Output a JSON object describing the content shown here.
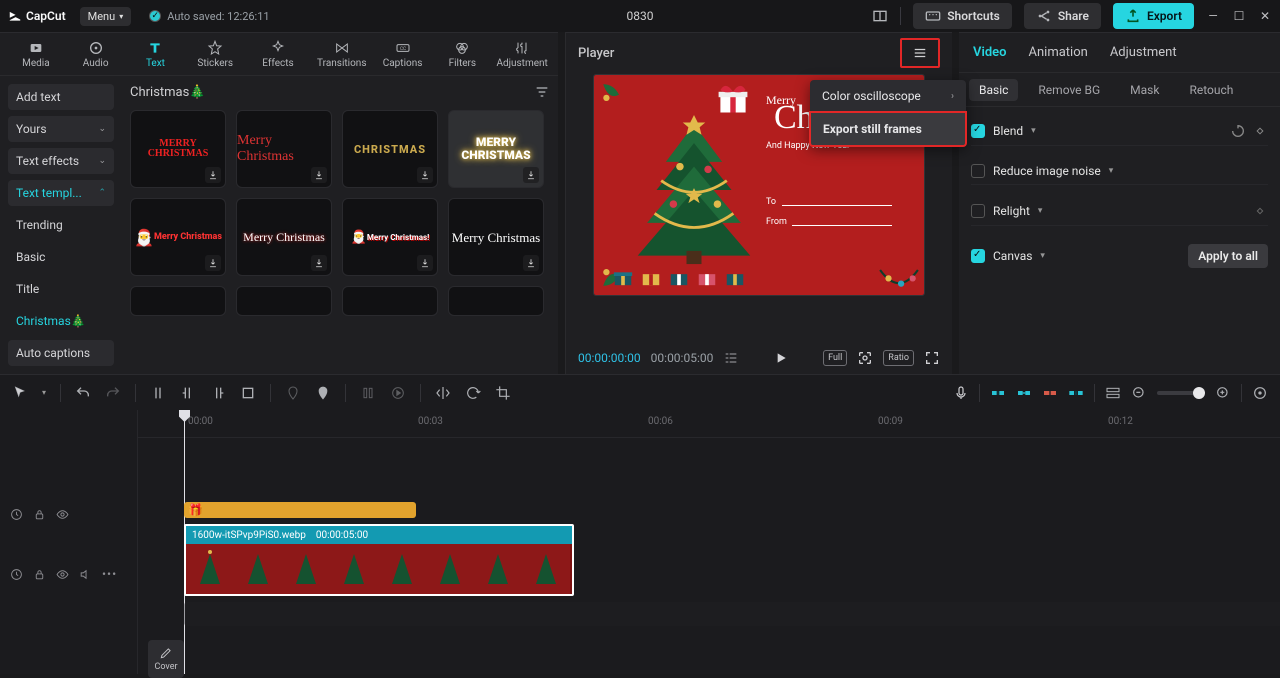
{
  "app": {
    "name": "CapCut",
    "menu": "Menu",
    "autosave": "Auto saved: 12:26:11",
    "project": "0830"
  },
  "titlebar": {
    "shortcuts": "Shortcuts",
    "share": "Share",
    "export": "Export"
  },
  "modules": [
    "Media",
    "Audio",
    "Text",
    "Stickers",
    "Effects",
    "Transitions",
    "Captions",
    "Filters",
    "Adjustment"
  ],
  "modules_active_index": 2,
  "sidebar": {
    "addtext": "Add text",
    "yours": "Yours",
    "texteffects": "Text effects",
    "texttemplates": "Text templ...",
    "trending": "Trending",
    "basic": "Basic",
    "title": "Title",
    "christmas": "Christmas🎄",
    "autocaptions": "Auto captions"
  },
  "gallery": {
    "heading": "Christmas🎄",
    "thumbs": [
      "MERRY CHRISTMAS",
      "Merry Christmas",
      "CHRISTMAS",
      "MERRY CHRISTMAS",
      "Merry Christmas",
      "Merry Christmas",
      "Merry Christmas!",
      "Merry Christmas"
    ]
  },
  "player": {
    "label": "Player",
    "menu": {
      "item1": "Color oscilloscope",
      "item2": "Export still frames"
    },
    "poster": {
      "merry": "Merry",
      "script": "Christmas",
      "sub": "And Happy New Year",
      "to": "To",
      "from": "From"
    },
    "time_current": "00:00:00:00",
    "time_duration": "00:00:05:00",
    "full": "Full",
    "ratio": "Ratio"
  },
  "right": {
    "tabs": [
      "Video",
      "Animation",
      "Adjustment"
    ],
    "subtabs": [
      "Basic",
      "Remove BG",
      "Mask",
      "Retouch"
    ],
    "blend": "Blend",
    "reduce": "Reduce image noise",
    "relight": "Relight",
    "canvas": "Canvas",
    "apply": "Apply to all"
  },
  "timeline": {
    "cover": "Cover",
    "ticks": [
      "00:00",
      "00:03",
      "00:06",
      "00:09",
      "00:12"
    ],
    "clip_name": "1600w-itSPvp9PiS0.webp",
    "clip_dur": "00:00:05:00"
  }
}
